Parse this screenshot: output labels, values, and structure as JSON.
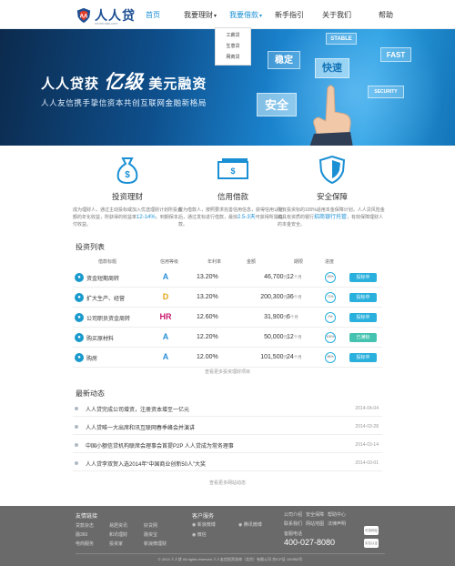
{
  "brand": {
    "name": "人人贷",
    "sub": "renrendai.com"
  },
  "nav": [
    "首页",
    "我要理财",
    "我要借款",
    "新手指引",
    "关于我们",
    "帮助"
  ],
  "dropdown": [
    "工薪贷",
    "生意贷",
    "网商贷"
  ],
  "banner": {
    "title_pre": "人人贷获",
    "title_big": "亿级",
    "title_post": "美元融资",
    "subtitle": "人人友信携手挚信资本共创互联网金融新格局",
    "tiles": [
      "STABLE",
      "FAST",
      "稳定",
      "快速",
      "安全",
      "SECURITY"
    ]
  },
  "features": [
    {
      "icon": "money-bag-icon",
      "title": "投资理财",
      "desc_pre": "成为理财人，通过主动投标或加入优选理财计划所投金额的年化收益，所获得的收益率",
      "highlight": "12-14%",
      "desc_post": "，到期保本付收益。"
    },
    {
      "icon": "cash-icon",
      "title": "信用借款",
      "desc_pre": "成为借款人，按照要求完善信用信息，获得信用认证后，通过发标进行借款，最快",
      "highlight": "2.5-3天",
      "desc_post": "可获得所需借款。"
    },
    {
      "icon": "shield-icon",
      "title": "安全保障",
      "desc_pre": "所有投资标的100%适用本金保障计划，人人贷风险金由具有资质的银行",
      "highlight": "招商银行托管",
      "desc_post": "，有效保障理财人的本金安全。"
    }
  ],
  "invest": {
    "title": "投资列表",
    "headers": [
      "借款标题",
      "信用等级",
      "年利率",
      "金额",
      "期限",
      "进度"
    ],
    "rows": [
      {
        "title": "资金短期周转",
        "level": "A",
        "level_color": "#2a8fd6",
        "rate": "13.20%",
        "amount": "46,700",
        "unit": "元",
        "term": "12",
        "term_unit": "个月",
        "progress": "33%",
        "action": "投标中",
        "done": false
      },
      {
        "title": "扩大生产、经营",
        "level": "D",
        "level_color": "#e5a416",
        "rate": "13.20%",
        "amount": "200,300",
        "unit": "元",
        "term": "36",
        "term_unit": "个月",
        "progress": "71%",
        "action": "投标中",
        "done": false
      },
      {
        "title": "公司职员资金周转",
        "level": "HR",
        "level_color": "#c8196c",
        "rate": "12.60%",
        "amount": "31,900",
        "unit": "元",
        "term": "6",
        "term_unit": "个月",
        "progress": "0%",
        "action": "投标中",
        "done": false
      },
      {
        "title": "购买原材料",
        "level": "A",
        "level_color": "#2a8fd6",
        "rate": "12.20%",
        "amount": "50,000",
        "unit": "元",
        "term": "12",
        "term_unit": "个月",
        "progress": "100%",
        "action": "已满标",
        "done": true
      },
      {
        "title": "购房",
        "level": "A",
        "level_color": "#2a8fd6",
        "rate": "12.00%",
        "amount": "101,500",
        "unit": "元",
        "term": "24",
        "term_unit": "个月",
        "progress": "56%",
        "action": "投标中",
        "done": false
      }
    ],
    "more": "查看更多投资理财项目"
  },
  "news": {
    "title": "最新动态",
    "items": [
      {
        "text": "人人贷完成公司增资，注册资本增至一亿元",
        "date": "2014-04-04"
      },
      {
        "text": "人人贷唯一大出席和讯互联网春季峰会并演讲",
        "date": "2014-03-28"
      },
      {
        "text": "中国小额信贷机构联席会理事会首提P2P 人人贷成为常务理事",
        "date": "2014-03-14"
      },
      {
        "text": "人人贷李双贺入选2014年“中国商业创新50人”大奖",
        "date": "2014-03-01"
      }
    ],
    "more": "查看更多网站动态"
  },
  "footer": {
    "links_title": "友情链接",
    "links": [
      "贷款杂志",
      "易居资讯",
      "好贷网",
      "融360",
      "和讯理财",
      "融资宝",
      "电商服务",
      "投资家",
      "新浪微理财"
    ],
    "service_title": "客户服务",
    "service": [
      "新浪微博",
      "腾讯微博",
      "微信"
    ],
    "bottom_links": [
      "公司介绍",
      "安全保障",
      "帮助中心",
      "联系我们",
      "网站地图",
      "法律声明"
    ],
    "phone_label": "客服电话",
    "phone": "400-027-8080",
    "copyright": "© 2014 人人贷 All rights reserved    人人友信投资咨询（北京）有限公司    京ICP证 100953号",
    "badges": [
      "可信网站",
      "实名认证"
    ]
  }
}
